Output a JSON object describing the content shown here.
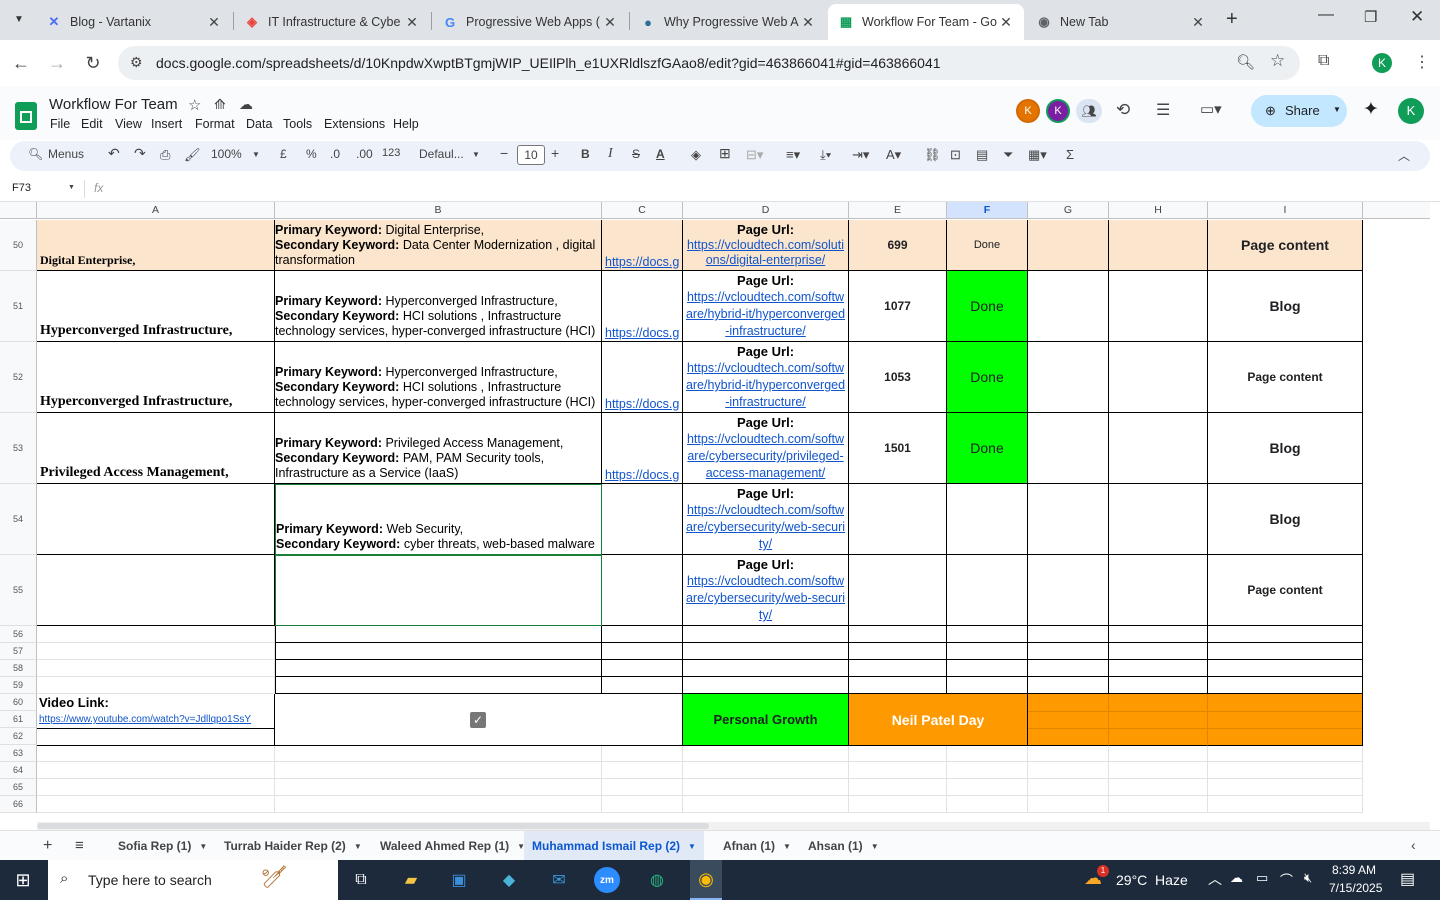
{
  "browser": {
    "tabs": [
      {
        "title": "Blog - Vartanix",
        "icon": "vartanix-icon",
        "fav": "✕",
        "color": "#4a6cf7"
      },
      {
        "title": "IT Infrastructure & Cybe",
        "icon": "vcloud-icon",
        "fav": "◈",
        "color": "#e8453c"
      },
      {
        "title": "Progressive Web Apps (",
        "icon": "google-icon",
        "fav": "G",
        "color": "#4285f4"
      },
      {
        "title": "Why Progressive Web A",
        "icon": "copilot-icon",
        "fav": "●",
        "color": "#2a6f97"
      },
      {
        "title": "Workflow For Team - Go",
        "icon": "sheets-icon",
        "fav": "▦",
        "color": "#0f9d58"
      },
      {
        "title": "New Tab",
        "icon": "chrome-icon",
        "fav": "◉",
        "color": "#5f6368"
      }
    ],
    "url": "docs.google.com/spreadsheets/d/10KnpdwXwptBTgmjWIP_UEIlPlh_e1UXRldlszfGAao8/edit?gid=463866041#gid=463866041"
  },
  "sheet": {
    "title": "Workflow For Team",
    "menu": [
      "File",
      "Edit",
      "View",
      "Insert",
      "Format",
      "Data",
      "Tools",
      "Extensions",
      "Help"
    ],
    "share_label": "Share",
    "avatar_letter": "K",
    "toolbar": {
      "menus_label": "Menus",
      "zoom": "100%",
      "currency": "£",
      "percent": "%",
      "dec_down": ".0",
      "dec_up": ".00",
      "number_format": "123",
      "font": "Defaul...",
      "font_size": "10",
      "bold": "B",
      "italic": "I",
      "sigma": "Σ"
    },
    "name_box": "F73",
    "fx": "fx",
    "columns": [
      "A",
      "B",
      "C",
      "D",
      "E",
      "F",
      "G",
      "H",
      "I"
    ],
    "rows": [
      {
        "num": "50",
        "a": "Digital Enterprise,",
        "pk": "Digital Enterprise,",
        "sk": "Data Center Modernization , digital transformation",
        "c": "https://docs.g",
        "page_url_label": "Page Url:",
        "d": "https://vcloudtech.com/solutions/digital-enterprise/",
        "e": "699",
        "f": "Done",
        "i": "Page content"
      },
      {
        "num": "51",
        "a": "Hyperconverged Infrastructure,",
        "pk": "Hyperconverged Infrastructure,",
        "sk": "HCI solutions , Infrastructure technology services, hyper-converged infrastructure (HCI)",
        "c": "https://docs.g",
        "page_url_label": "Page Url:",
        "d": "https://vcloudtech.com/software/hybrid-it/hyperconverged-infrastructure/",
        "e": "1077",
        "f": "Done",
        "i": "Blog"
      },
      {
        "num": "52",
        "a": "Hyperconverged Infrastructure,",
        "pk": "Hyperconverged Infrastructure,",
        "sk": "HCI solutions , Infrastructure technology services, hyper-converged infrastructure (HCI)",
        "c": "https://docs.g",
        "page_url_label": "Page Url:",
        "d": "https://vcloudtech.com/software/hybrid-it/hyperconverged-infrastructure/",
        "e": "1053",
        "f": "Done",
        "i": "Page content"
      },
      {
        "num": "53",
        "a": "Privileged Access Management,",
        "pk": "Privileged Access Management,",
        "sk": "PAM, PAM Security tools, Infrastructure as a Service (IaaS)",
        "c": "https://docs.g",
        "page_url_label": "Page Url:",
        "d": "https://vcloudtech.com/software/cybersecurity/privileged-access-management/",
        "e": "1501",
        "f": "Done",
        "i": "Blog"
      },
      {
        "num": "54",
        "a": "",
        "pk": "Web Security,",
        "sk": "cyber threats, web-based malware",
        "c": "",
        "page_url_label": "Page Url:",
        "d": "https://vcloudtech.com/software/cybersecurity/web-security/",
        "e": "",
        "f": "",
        "i": "Blog"
      },
      {
        "num": "55",
        "a": "",
        "pk": "",
        "sk": "",
        "c": "",
        "page_url_label": "Page Url:",
        "d": "https://vcloudtech.com/software/cybersecurity/web-security/",
        "e": "",
        "f": "",
        "i": "Page content"
      }
    ],
    "labels": {
      "primary": "Primary Keyword:",
      "secondary": "Secondary Keyword:"
    },
    "small_rows": [
      "56",
      "57",
      "58",
      "59",
      "60",
      "61",
      "62",
      "63",
      "64",
      "65",
      "66"
    ],
    "video_label": "Video Link:",
    "video_url": "https://www.youtube.com/watch?v=Jdllqpo1SsY",
    "personal_growth": "Personal Growth",
    "neil_patel_day": "Neil Patel Day",
    "sheet_tabs": [
      {
        "label": "Sofia Rep (1)"
      },
      {
        "label": "Turrab Haider Rep (2)"
      },
      {
        "label": "Waleed Ahmed Rep (1)"
      },
      {
        "label": "Muhammad Ismail Rep (2)"
      },
      {
        "label": "Afnan (1)"
      },
      {
        "label": "Ahsan (1)"
      }
    ],
    "colors": {
      "done_green": "#00ff00",
      "orange": "#ff9900",
      "peach": "#fce5cd",
      "selected_tab": "#0b57d0"
    }
  },
  "taskbar": {
    "search_placeholder": "Type here to search",
    "weather": "29°C  Haze",
    "time": "8:39 AM",
    "date": "7/15/2025",
    "notification_count": "1"
  }
}
